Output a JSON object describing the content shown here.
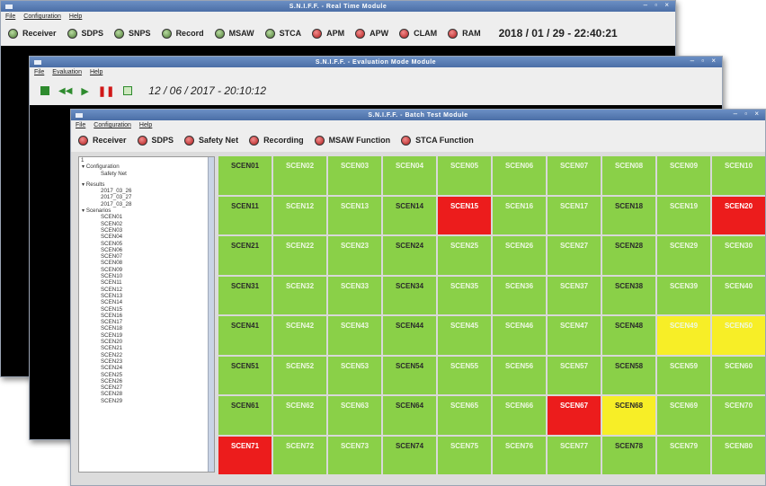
{
  "realtime": {
    "title": "S.N.I.F.F. - Real Time Module",
    "menu": [
      "File",
      "Configuration",
      "Help"
    ],
    "status": [
      {
        "label": "Receiver",
        "state": "green"
      },
      {
        "label": "SDPS",
        "state": "green"
      },
      {
        "label": "SNPS",
        "state": "green"
      },
      {
        "label": "Record",
        "state": "green"
      },
      {
        "label": "MSAW",
        "state": "green"
      },
      {
        "label": "STCA",
        "state": "green"
      },
      {
        "label": "APM",
        "state": "red"
      },
      {
        "label": "APW",
        "state": "red"
      },
      {
        "label": "CLAM",
        "state": "red"
      },
      {
        "label": "RAM",
        "state": "red"
      }
    ],
    "datetime": "2018 / 01 / 29 - 22:40:21"
  },
  "evaluation": {
    "title": "S.N.I.F.F. - Evaluation Mode Module",
    "menu": [
      "File",
      "Evaluation",
      "Help"
    ],
    "datetime": "12 / 06 / 2017 - 20:10:12"
  },
  "batch": {
    "title": "S.N.I.F.F. - Batch Test Module",
    "menu": [
      "File",
      "Configuration",
      "Help"
    ],
    "status": [
      {
        "label": "Receiver",
        "state": "red"
      },
      {
        "label": "SDPS",
        "state": "red"
      },
      {
        "label": "Safety Net",
        "state": "red"
      },
      {
        "label": "Recording",
        "state": "red"
      },
      {
        "label": "MSAW Function",
        "state": "red"
      },
      {
        "label": "STCA Function",
        "state": "red"
      }
    ],
    "tree": {
      "field_value": "1",
      "configuration_label": "Configuration",
      "configuration_items": [
        "Safety Net"
      ],
      "results_label": "Results",
      "results_items": [
        "2017_03_26",
        "2017_03_27",
        "2017_03_28"
      ],
      "scenarios_label": "Scenarios",
      "scenario_items": [
        "SCEN01",
        "SCEN02",
        "SCEN03",
        "SCEN04",
        "SCEN05",
        "SCEN06",
        "SCEN07",
        "SCEN08",
        "SCEN09",
        "SCEN10",
        "SCEN11",
        "SCEN12",
        "SCEN13",
        "SCEN14",
        "SCEN15",
        "SCEN16",
        "SCEN17",
        "SCEN18",
        "SCEN19",
        "SCEN20",
        "SCEN21",
        "SCEN22",
        "SCEN23",
        "SCEN24",
        "SCEN25",
        "SCEN26",
        "SCEN27",
        "SCEN28",
        "SCEN29"
      ]
    },
    "grid": [
      [
        {
          "id": "SCEN01",
          "c": "g",
          "d": 0
        },
        {
          "id": "SCEN02",
          "c": "g",
          "d": 1
        },
        {
          "id": "SCEN03",
          "c": "g",
          "d": 1
        },
        {
          "id": "SCEN04",
          "c": "g",
          "d": 1
        },
        {
          "id": "SCEN05",
          "c": "g",
          "d": 1
        },
        {
          "id": "SCEN06",
          "c": "g",
          "d": 1
        },
        {
          "id": "SCEN07",
          "c": "g",
          "d": 1
        },
        {
          "id": "SCEN08",
          "c": "g",
          "d": 1
        },
        {
          "id": "SCEN09",
          "c": "g",
          "d": 1
        },
        {
          "id": "SCEN10",
          "c": "g",
          "d": 1
        }
      ],
      [
        {
          "id": "SCEN11",
          "c": "g",
          "d": 0
        },
        {
          "id": "SCEN12",
          "c": "g",
          "d": 1
        },
        {
          "id": "SCEN13",
          "c": "g",
          "d": 1
        },
        {
          "id": "SCEN14",
          "c": "g",
          "d": 0
        },
        {
          "id": "SCEN15",
          "c": "r",
          "d": 0
        },
        {
          "id": "SCEN16",
          "c": "g",
          "d": 1
        },
        {
          "id": "SCEN17",
          "c": "g",
          "d": 1
        },
        {
          "id": "SCEN18",
          "c": "g",
          "d": 0
        },
        {
          "id": "SCEN19",
          "c": "g",
          "d": 1
        },
        {
          "id": "SCEN20",
          "c": "r",
          "d": 0
        }
      ],
      [
        {
          "id": "SCEN21",
          "c": "g",
          "d": 0
        },
        {
          "id": "SCEN22",
          "c": "g",
          "d": 1
        },
        {
          "id": "SCEN23",
          "c": "g",
          "d": 1
        },
        {
          "id": "SCEN24",
          "c": "g",
          "d": 0
        },
        {
          "id": "SCEN25",
          "c": "g",
          "d": 1
        },
        {
          "id": "SCEN26",
          "c": "g",
          "d": 1
        },
        {
          "id": "SCEN27",
          "c": "g",
          "d": 1
        },
        {
          "id": "SCEN28",
          "c": "g",
          "d": 0
        },
        {
          "id": "SCEN29",
          "c": "g",
          "d": 1
        },
        {
          "id": "SCEN30",
          "c": "g",
          "d": 1
        }
      ],
      [
        {
          "id": "SCEN31",
          "c": "g",
          "d": 0
        },
        {
          "id": "SCEN32",
          "c": "g",
          "d": 1
        },
        {
          "id": "SCEN33",
          "c": "g",
          "d": 1
        },
        {
          "id": "SCEN34",
          "c": "g",
          "d": 0
        },
        {
          "id": "SCEN35",
          "c": "g",
          "d": 1
        },
        {
          "id": "SCEN36",
          "c": "g",
          "d": 1
        },
        {
          "id": "SCEN37",
          "c": "g",
          "d": 1
        },
        {
          "id": "SCEN38",
          "c": "g",
          "d": 0
        },
        {
          "id": "SCEN39",
          "c": "g",
          "d": 1
        },
        {
          "id": "SCEN40",
          "c": "g",
          "d": 1
        }
      ],
      [
        {
          "id": "SCEN41",
          "c": "g",
          "d": 0
        },
        {
          "id": "SCEN42",
          "c": "g",
          "d": 1
        },
        {
          "id": "SCEN43",
          "c": "g",
          "d": 1
        },
        {
          "id": "SCEN44",
          "c": "g",
          "d": 0
        },
        {
          "id": "SCEN45",
          "c": "g",
          "d": 1
        },
        {
          "id": "SCEN46",
          "c": "g",
          "d": 1
        },
        {
          "id": "SCEN47",
          "c": "g",
          "d": 1
        },
        {
          "id": "SCEN48",
          "c": "g",
          "d": 0
        },
        {
          "id": "SCEN49",
          "c": "y",
          "d": 1
        },
        {
          "id": "SCEN50",
          "c": "y",
          "d": 1
        }
      ],
      [
        {
          "id": "SCEN51",
          "c": "g",
          "d": 0
        },
        {
          "id": "SCEN52",
          "c": "g",
          "d": 1
        },
        {
          "id": "SCEN53",
          "c": "g",
          "d": 1
        },
        {
          "id": "SCEN54",
          "c": "g",
          "d": 0
        },
        {
          "id": "SCEN55",
          "c": "g",
          "d": 1
        },
        {
          "id": "SCEN56",
          "c": "g",
          "d": 1
        },
        {
          "id": "SCEN57",
          "c": "g",
          "d": 1
        },
        {
          "id": "SCEN58",
          "c": "g",
          "d": 0
        },
        {
          "id": "SCEN59",
          "c": "g",
          "d": 1
        },
        {
          "id": "SCEN60",
          "c": "g",
          "d": 1
        }
      ],
      [
        {
          "id": "SCEN61",
          "c": "g",
          "d": 0
        },
        {
          "id": "SCEN62",
          "c": "g",
          "d": 1
        },
        {
          "id": "SCEN63",
          "c": "g",
          "d": 1
        },
        {
          "id": "SCEN64",
          "c": "g",
          "d": 0
        },
        {
          "id": "SCEN65",
          "c": "g",
          "d": 1
        },
        {
          "id": "SCEN66",
          "c": "g",
          "d": 1
        },
        {
          "id": "SCEN67",
          "c": "r",
          "d": 0
        },
        {
          "id": "SCEN68",
          "c": "y",
          "d": 0
        },
        {
          "id": "SCEN69",
          "c": "g",
          "d": 1
        },
        {
          "id": "SCEN70",
          "c": "g",
          "d": 1
        }
      ],
      [
        {
          "id": "SCEN71",
          "c": "r",
          "d": 0
        },
        {
          "id": "SCEN72",
          "c": "g",
          "d": 1
        },
        {
          "id": "SCEN73",
          "c": "g",
          "d": 1
        },
        {
          "id": "SCEN74",
          "c": "g",
          "d": 0
        },
        {
          "id": "SCEN75",
          "c": "g",
          "d": 1
        },
        {
          "id": "SCEN76",
          "c": "g",
          "d": 1
        },
        {
          "id": "SCEN77",
          "c": "g",
          "d": 1
        },
        {
          "id": "SCEN78",
          "c": "g",
          "d": 0
        },
        {
          "id": "SCEN79",
          "c": "g",
          "d": 1
        },
        {
          "id": "SCEN80",
          "c": "g",
          "d": 1
        }
      ]
    ]
  },
  "colors": {
    "green": "#8ad048",
    "red": "#ec1c1c",
    "yellow": "#f7ee27",
    "titlebar": "#5a7fb8"
  }
}
